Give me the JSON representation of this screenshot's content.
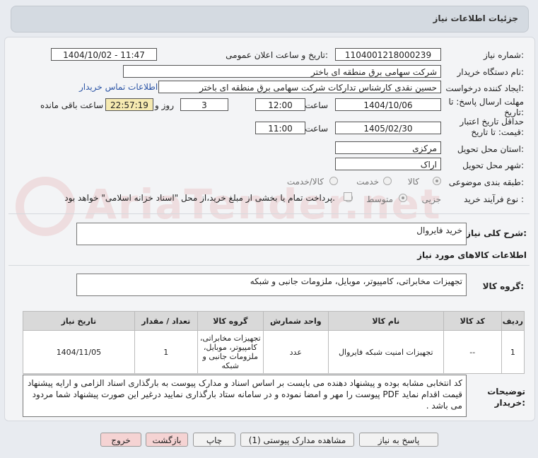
{
  "header": {
    "title": "جزئیات اطلاعات نیاز"
  },
  "fields": {
    "need_number": {
      "label": "شماره نیاز:",
      "value": "1104001218000239"
    },
    "announce_datetime": {
      "label": "تاریخ و ساعت اعلان عمومی:",
      "value": "1404/10/02 - 11:47"
    },
    "buyer_org": {
      "label": "نام دستگاه خریدار:",
      "value": "شرکت سهامی برق منطقه ای باختر"
    },
    "requester": {
      "label": "ایجاد کننده درخواست:",
      "value": "حسین نقدی کارشناس تدارکات شرکت سهامی برق منطقه ای باختر",
      "contact_link": "اطلاعات تماس خریدار"
    },
    "reply_deadline": {
      "label": "مهلت ارسال پاسخ: تا تاریخ:",
      "date": "1404/10/06",
      "time_label": "ساعت",
      "time": "12:00",
      "days": "3",
      "days_label": "روز و",
      "remaining": "22:57:19",
      "remaining_label": "ساعت باقی مانده"
    },
    "price_validity": {
      "label": "حداقل تاریخ اعتبار قیمت: تا تاریخ:",
      "date": "1405/02/30",
      "time_label": "ساعت",
      "time": "11:00"
    },
    "province": {
      "label": "استان محل تحویل:",
      "value": "مرکزی"
    },
    "city": {
      "label": "شهر محل تحویل:",
      "value": "اراک"
    },
    "category": {
      "label": "طبقه بندی موضوعی:",
      "options": [
        "کالا",
        "خدمت",
        "کالا/خدمت"
      ],
      "selected": "کالا"
    },
    "purchase_type": {
      "label": "نوع فرآیند خرید :",
      "options": [
        "جزیی",
        "متوسط"
      ],
      "selected": "جزیی",
      "payment_note": "پرداخت تمام یا بخشی از مبلغ خرید،از محل \"اسناد خزانه اسلامی\" خواهد بود."
    }
  },
  "summary": {
    "label": "شرح کلی نیاز:",
    "value": "خرید فایروال"
  },
  "goods_info_title": "اطلاعات کالاهای مورد نیاز",
  "goods_group": {
    "label": "گروه کالا:",
    "value": "تجهیزات مخابراتی، کامپیوتر، موبایل، ملزومات جانبی و شبکه"
  },
  "table": {
    "headers": [
      "ردیف",
      "کد کالا",
      "نام کالا",
      "واحد شمارش",
      "گروه کالا",
      "تعداد / مقدار",
      "تاریخ نیاز"
    ],
    "rows": [
      [
        "1",
        "--",
        "تجهیزات امنیت شبکه فایروال",
        "عدد",
        "تجهیزات مخابراتی، کامپیوتر، موبایل، ملزومات جانبی و شبکه",
        "1",
        "1404/11/05"
      ]
    ]
  },
  "buyer_notes": {
    "label": "توضیحات خریدار:",
    "value": "کد انتخابی مشابه بوده و پیشنهاد دهنده می بایست بر اساس اسناد و مدارک پیوست به بارگذاری اسناد الزامی و ارایه پیشنهاد قیمت اقدام نماید PDF پیوست را مهر و امضا نموده و در سامانه ستاد بارگذاری نمایید درغیر این صورت پیشنهاد شما مردود می باشد ."
  },
  "buttons": {
    "reply": "پاسخ به نیاز",
    "attachments": "مشاهده مدارک پیوستی (1)",
    "print": "چاپ",
    "back": "بازگشت",
    "exit": "خروج"
  },
  "watermark": "AriaTender.net"
}
